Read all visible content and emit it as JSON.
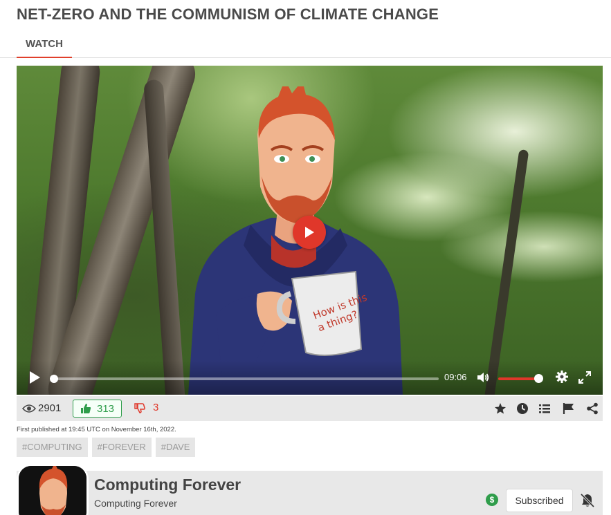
{
  "video": {
    "title": "NET-ZERO AND THE COMMUNISM OF CLIMATE CHANGE",
    "time": "09:06",
    "mug_text": "How is this a thing?",
    "progress_fraction": 0.0,
    "volume_fraction": 0.9
  },
  "tabs": [
    {
      "label": "WATCH",
      "active": true
    }
  ],
  "stats": {
    "views": "2901",
    "likes": "313",
    "dislikes": "3"
  },
  "actions": [
    "star-icon",
    "clock-icon",
    "playlist-icon",
    "flag-icon",
    "share-icon"
  ],
  "published": "First published at 19:45 UTC on November 16th, 2022.",
  "tags": [
    "#COMPUTING",
    "#FOREVER",
    "#DAVE"
  ],
  "channel": {
    "name": "Computing Forever",
    "handle": "Computing Forever",
    "donate_symbol": "$",
    "subscribe_label": "Subscribed"
  },
  "colors": {
    "accent": "#e0372a",
    "like_green": "#2f9d4b",
    "bar_gray": "#e8e8e8"
  }
}
